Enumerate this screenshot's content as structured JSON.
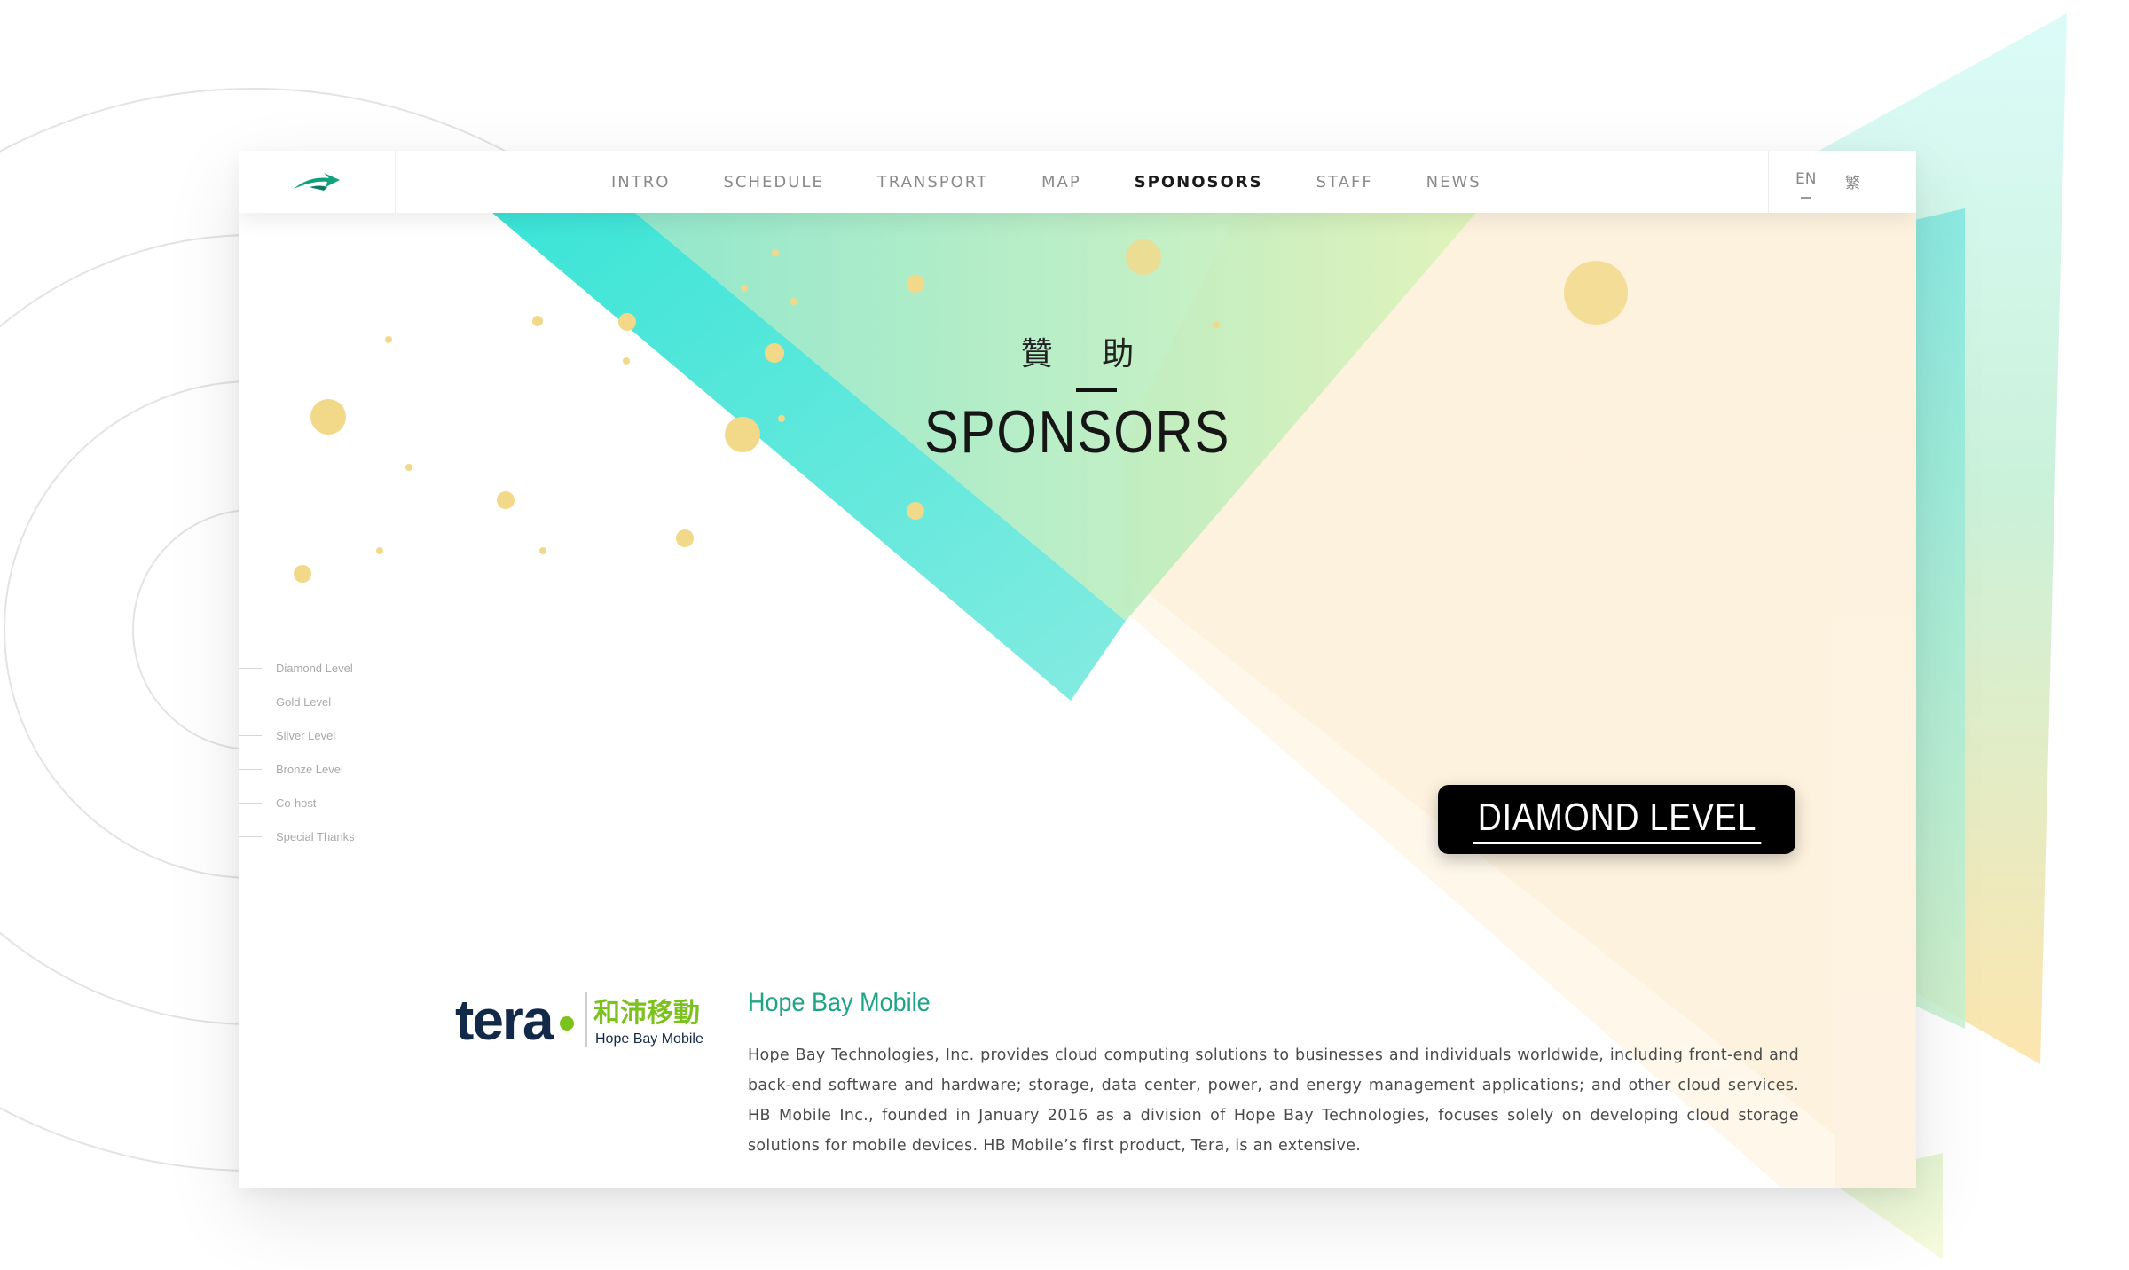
{
  "nav": {
    "logo_name": "bird-logo-icon",
    "links": [
      "INTRO",
      "SCHEDULE",
      "TRANSPORT",
      "MAP",
      "SPONOSORS",
      "STAFF",
      "NEWS"
    ],
    "active_index": 4,
    "lang_en": "EN",
    "lang_zh": "繁"
  },
  "hero": {
    "title_zh": "贊 助",
    "title_en": "SPONSORS"
  },
  "side_nav": {
    "items": [
      "Diamond Level",
      "Gold Level",
      "Silver Level",
      "Bronze Level",
      "Co-host",
      "Special Thanks"
    ]
  },
  "level": {
    "label": "DIAMOND LEVEL"
  },
  "sponsor": {
    "logo_word": "tera",
    "logo_cjk": "和沛移動",
    "logo_sub": "Hope Bay Mobile",
    "name": "Hope Bay Mobile",
    "description": "Hope Bay Technologies, Inc. provides cloud computing solutions to businesses and individuals worldwide, including front-end and back-end software and hardware; storage, data center, power, and energy management applications; and other cloud services. HB Mobile Inc., founded in January 2016 as a division of Hope Bay Technologies, focuses solely on developing cloud storage solutions for mobile devices. HB Mobile’s first product, Tera, is an extensive."
  },
  "colors": {
    "teal": "#3fe3d4",
    "mint": "#b4ecc0",
    "peach": "#fdeccc",
    "dot": "#f2d98a",
    "accent_green": "#1fa488",
    "badge": "#000000"
  }
}
